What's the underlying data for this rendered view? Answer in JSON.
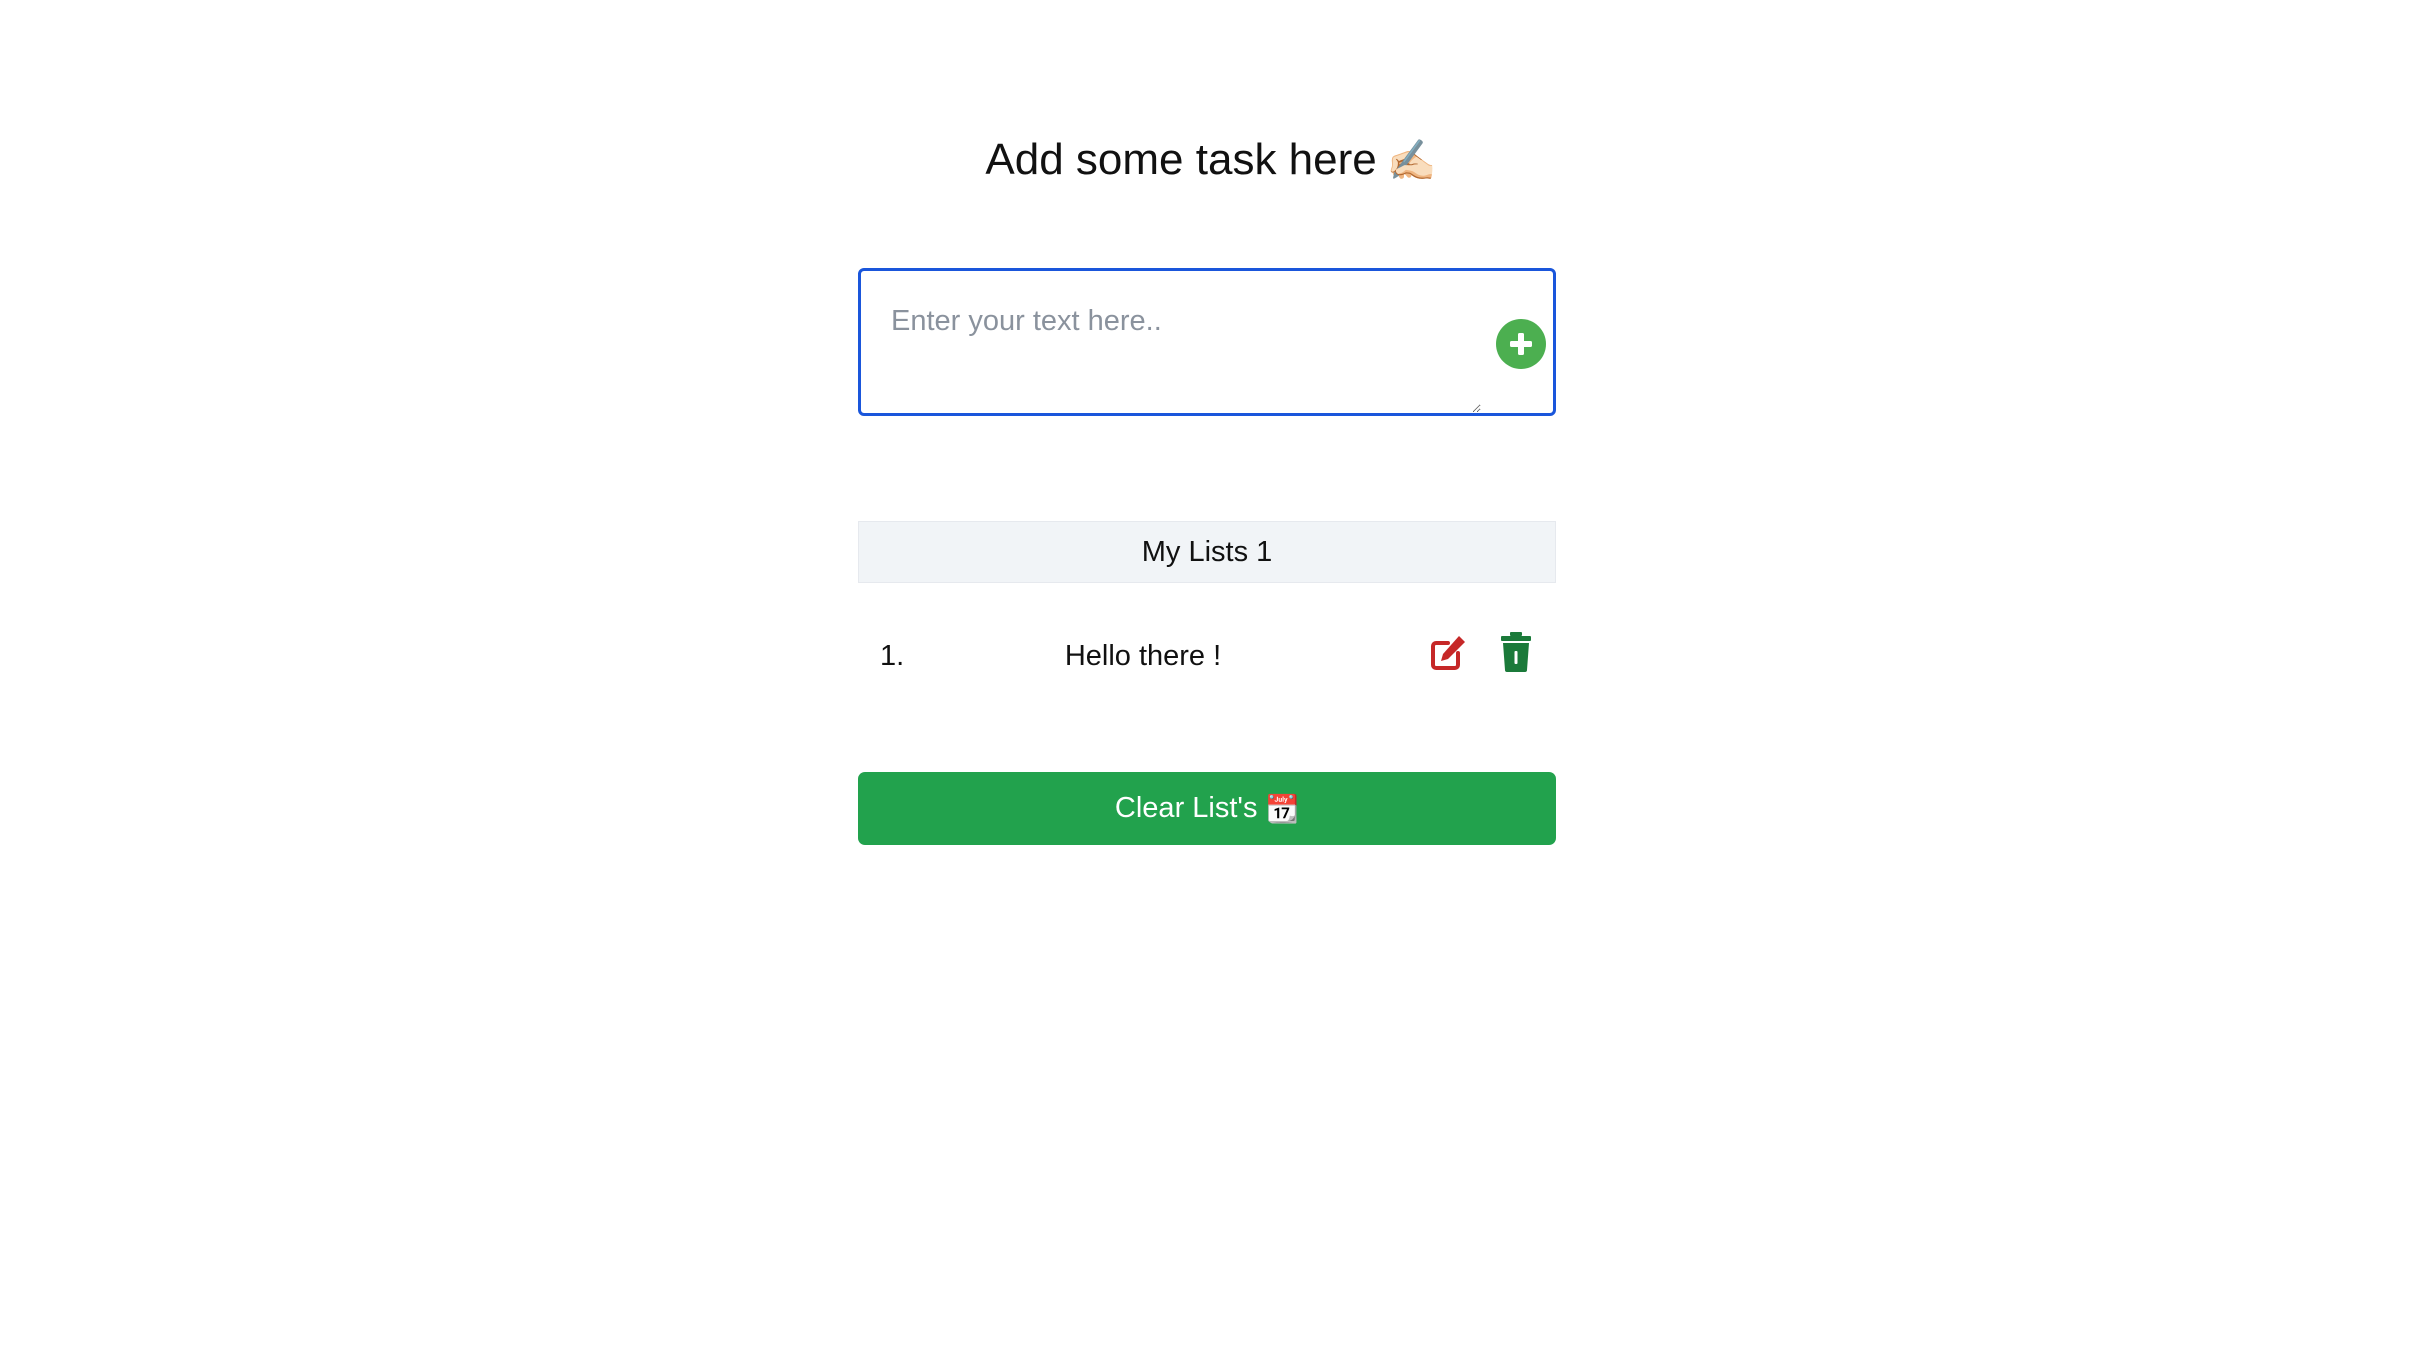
{
  "header": {
    "title": "Add some task here",
    "emoji": "✍🏻"
  },
  "input": {
    "placeholder": "Enter your text here..",
    "value": ""
  },
  "add_button": {
    "icon": "plus-circle-icon",
    "color": "#4caf50"
  },
  "list": {
    "header": "My Lists 1",
    "items": [
      {
        "index": "1.",
        "text": "Hello there !",
        "edit_icon": "edit-icon",
        "delete_icon": "trash-icon"
      }
    ]
  },
  "clear_button": {
    "label": "Clear List's",
    "emoji": "📆",
    "color": "#22a24d"
  },
  "colors": {
    "edit_icon": "#c62828",
    "delete_icon": "#1b7a3a",
    "input_border": "#1a56db",
    "list_header_bg": "#f1f4f7"
  }
}
